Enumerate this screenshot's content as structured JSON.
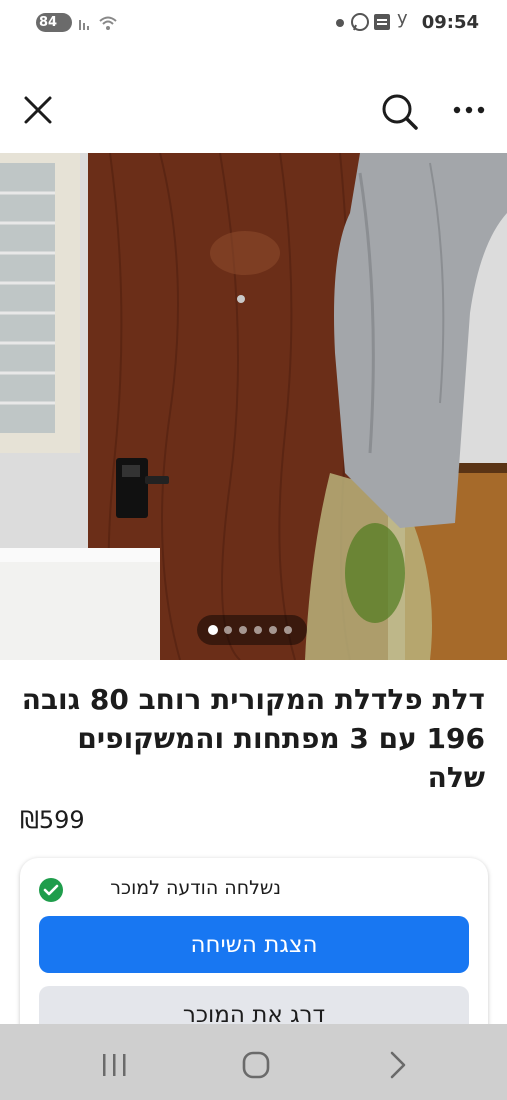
{
  "status_bar": {
    "battery": "84",
    "clock": "09:54",
    "notification_letter": "y"
  },
  "top_bar": {
    "close_icon": "close-icon",
    "search_icon": "search-icon",
    "more_icon": "more-icon"
  },
  "listing": {
    "title": "דלת פלדלת המקורית רוחב 80 גובה 196 עם 3 מפתחות והמשקופים שלה",
    "price": "₪599",
    "photo_count": 6,
    "photo_index": 1
  },
  "seller_card": {
    "message_sent": "נשלחה הודעה למוכר",
    "view_chat_label": "הצגת השיחה",
    "rate_seller_label": "דרג את המוכר"
  },
  "colors": {
    "accent": "#1877f2",
    "success": "#1f9d4c"
  }
}
